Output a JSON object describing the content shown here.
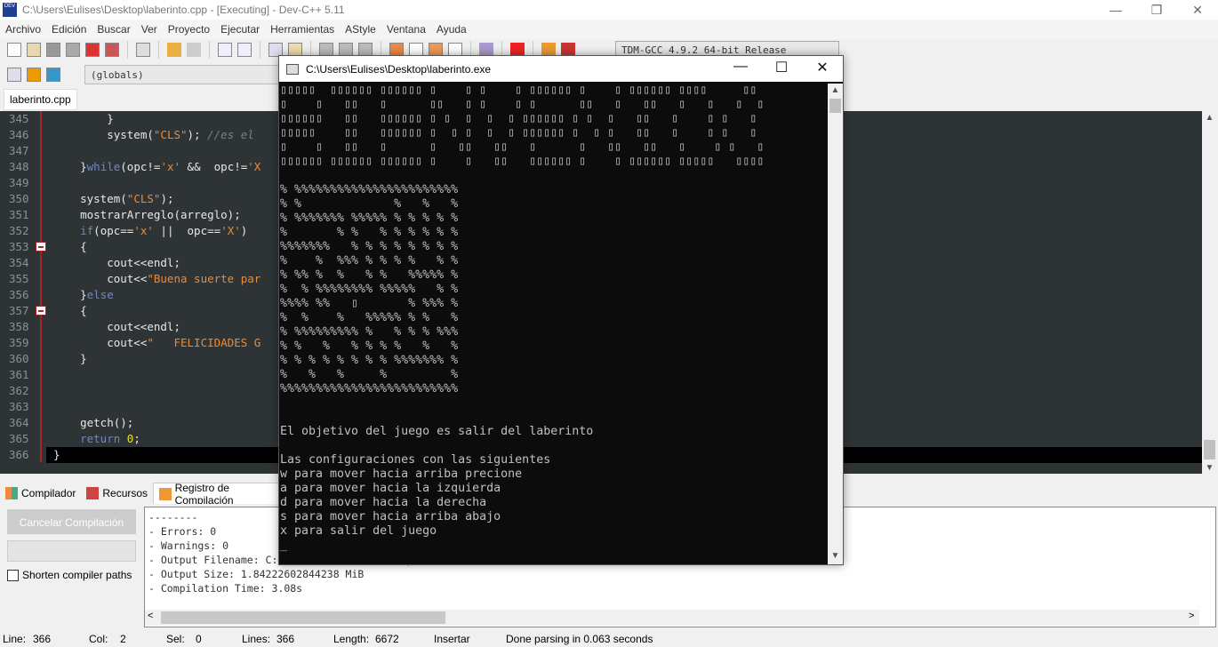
{
  "window": {
    "title": "C:\\Users\\Eulises\\Desktop\\laberinto.cpp - [Executing] - Dev-C++ 5.11",
    "minimize": "—",
    "restore": "❐",
    "close": "✕"
  },
  "menu": [
    "Archivo",
    "Edición",
    "Buscar",
    "Ver",
    "Proyecto",
    "Ejecutar",
    "Herramientas",
    "AStyle",
    "Ventana",
    "Ayuda"
  ],
  "toolbar": {
    "compiler_select": "TDM-GCC 4.9.2 64-bit Release",
    "scope_select": "(globals)"
  },
  "editor": {
    "file_tab": "laberinto.cpp",
    "line_numbers": [
      "345",
      "346",
      "347",
      "348",
      "349",
      "350",
      "351",
      "352",
      "353",
      "354",
      "355",
      "356",
      "357",
      "358",
      "359",
      "360",
      "361",
      "362",
      "363",
      "364",
      "365",
      "366"
    ],
    "lines": [
      [
        {
          "t": "        }",
          "c": ""
        }
      ],
      [
        {
          "t": "        system(",
          "c": ""
        },
        {
          "t": "\"CLS\"",
          "c": "st"
        },
        {
          "t": "); ",
          "c": ""
        },
        {
          "t": "//es el",
          "c": "cm"
        }
      ],
      [],
      [
        {
          "t": "    }",
          "c": ""
        },
        {
          "t": "while",
          "c": "kw"
        },
        {
          "t": "(opc!=",
          "c": ""
        },
        {
          "t": "'x'",
          "c": "st"
        },
        {
          "t": " &&  opc!=",
          "c": ""
        },
        {
          "t": "'X",
          "c": "st"
        }
      ],
      [],
      [
        {
          "t": "    system(",
          "c": ""
        },
        {
          "t": "\"CLS\"",
          "c": "st"
        },
        {
          "t": ");",
          "c": ""
        }
      ],
      [
        {
          "t": "    mostrarArreglo(arreglo);",
          "c": ""
        }
      ],
      [
        {
          "t": "    ",
          "c": ""
        },
        {
          "t": "if",
          "c": "kw"
        },
        {
          "t": "(opc==",
          "c": ""
        },
        {
          "t": "'x'",
          "c": "st"
        },
        {
          "t": " ||  opc==",
          "c": ""
        },
        {
          "t": "'X'",
          "c": "st"
        },
        {
          "t": ")",
          "c": ""
        }
      ],
      [
        {
          "t": "    {",
          "c": ""
        }
      ],
      [
        {
          "t": "        cout<<endl;",
          "c": ""
        }
      ],
      [
        {
          "t": "        cout<<",
          "c": ""
        },
        {
          "t": "\"Buena suerte par",
          "c": "st"
        }
      ],
      [
        {
          "t": "    }",
          "c": ""
        },
        {
          "t": "else",
          "c": "kw"
        }
      ],
      [
        {
          "t": "    {",
          "c": ""
        }
      ],
      [
        {
          "t": "        cout<<endl;",
          "c": ""
        }
      ],
      [
        {
          "t": "        cout<<",
          "c": ""
        },
        {
          "t": "\"   FELICIDADES G",
          "c": "st"
        }
      ],
      [
        {
          "t": "    }",
          "c": ""
        }
      ],
      [],
      [],
      [],
      [
        {
          "t": "    getch();",
          "c": ""
        }
      ],
      [
        {
          "t": "    ",
          "c": ""
        },
        {
          "t": "return",
          "c": "kw"
        },
        {
          "t": " ",
          "c": ""
        },
        {
          "t": "0",
          "c": "nm"
        },
        {
          "t": ";",
          "c": ""
        }
      ],
      [
        {
          "t": "}",
          "c": ""
        }
      ]
    ]
  },
  "bottom_tabs": [
    "Compilador",
    "Recursos",
    "Registro de Compilación"
  ],
  "compile_panel": {
    "cancel_button": "Cancelar Compilación",
    "shorten_paths": "Shorten compiler paths",
    "shorten_checked": false,
    "log": "--------\n- Errors: 0\n- Warnings: 0\n- Output Filename: C:\\Users\\Eulises\\Desktop\\laberinto.exe\n- Output Size: 1.84222602844238 MiB\n- Compilation Time: 3.08s"
  },
  "status": {
    "line": "Line:",
    "line_val": "366",
    "col": "Col:",
    "col_val": "2",
    "sel": "Sel:",
    "sel_val": "0",
    "lines": "Lines:",
    "lines_val": "366",
    "length": "Length:",
    "length_val": "6672",
    "mode": "Insertar",
    "parse": "Done parsing in 0.063 seconds"
  },
  "console": {
    "title": "C:\\Users\\Eulises\\Desktop\\laberinto.exe",
    "banner": [
      "▯▯▯▯▯  ▯▯▯▯▯▯ ▯▯▯▯▯▯ ▯    ▯ ▯    ▯ ▯▯▯▯▯▯ ▯    ▯ ▯▯▯▯▯▯ ▯▯▯▯     ▯▯",
      "▯    ▯   ▯▯   ▯      ▯▯   ▯ ▯    ▯ ▯      ▯▯   ▯   ▯▯   ▯   ▯   ▯  ▯",
      "▯▯▯▯▯▯   ▯▯   ▯▯▯▯▯▯ ▯ ▯  ▯  ▯  ▯ ▯▯▯▯▯▯ ▯ ▯  ▯   ▯▯   ▯    ▯ ▯   ▯",
      "▯▯▯▯▯    ▯▯   ▯▯▯▯▯▯ ▯  ▯ ▯  ▯  ▯ ▯▯▯▯▯▯ ▯  ▯ ▯   ▯▯   ▯    ▯ ▯   ▯",
      "▯    ▯   ▯▯   ▯      ▯   ▯▯   ▯▯   ▯      ▯   ▯▯   ▯▯   ▯    ▯ ▯   ▯",
      "▯▯▯▯▯▯ ▯▯▯▯▯▯ ▯▯▯▯▯▯ ▯    ▯   ▯▯   ▯▯▯▯▯▯ ▯    ▯ ▯▯▯▯▯▯ ▯▯▯▯▯   ▯▯▯▯"
    ],
    "maze": [
      "% %%%%%%%%%%%%%%%%%%%%%%%",
      "% %             %   %   %",
      "% %%%%%%% %%%%% % % % % %",
      "%       % %   % % % % % %",
      "%%%%%%%   % % % % % % % %",
      "%    %  %%% % % % %   % %",
      "% %% %  %   % %   %%%%% %",
      "%  % %%%%%%%% %%%%%   % %",
      "%%%% %%   ▯       % %%% %",
      "%  %    %   %%%%% % %   %",
      "% %%%%%%%%% %   % % % %%%",
      "% %   %   % % % %   %   %",
      "% % % % % % % % %%%%%%% %",
      "%   %   %     %         %",
      "%%%%%%%%%%%%%%%%%%%%%%%%%"
    ],
    "objective": "El objetivo del juego es salir del laberinto",
    "instructions_title": "Las configuraciones con las siguientes",
    "instructions": [
      "w para mover hacia arriba precione",
      "a para mover hacia la izquierda",
      "d para mover hacia la derecha",
      "s para mover hacia arriba abajo",
      "x para salir del juego"
    ],
    "cursor": "_"
  }
}
